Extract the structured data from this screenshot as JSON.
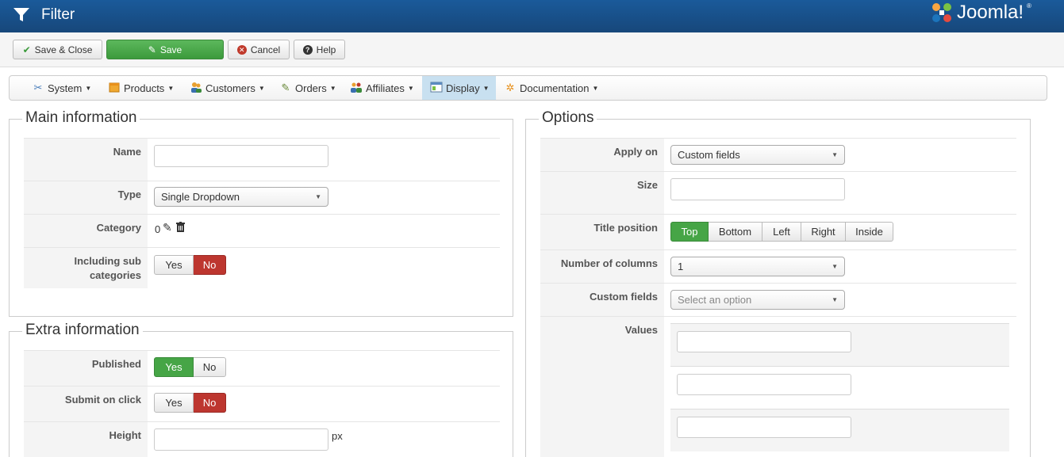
{
  "header": {
    "title": "Filter",
    "logo_text": "Joomla!",
    "logo_mark": "®"
  },
  "toolbar": {
    "save_close": "Save & Close",
    "save": "Save",
    "cancel": "Cancel",
    "help": "Help"
  },
  "menu": {
    "items": [
      {
        "label": "System",
        "icon": "tools-icon"
      },
      {
        "label": "Products",
        "icon": "box-icon"
      },
      {
        "label": "Customers",
        "icon": "users-icon"
      },
      {
        "label": "Orders",
        "icon": "pen-icon"
      },
      {
        "label": "Affiliates",
        "icon": "group-icon"
      },
      {
        "label": "Display",
        "icon": "display-icon",
        "active": true
      },
      {
        "label": "Documentation",
        "icon": "doc-icon"
      }
    ]
  },
  "main_info": {
    "legend": "Main information",
    "name_label": "Name",
    "name_value": "",
    "type_label": "Type",
    "type_value": "Single Dropdown",
    "category_label": "Category",
    "category_value": "0",
    "sub_label_1": "Including sub",
    "sub_label_2": "categories",
    "sub_yes": "Yes",
    "sub_no": "No",
    "sub_selected": "No"
  },
  "extra_info": {
    "legend": "Extra information",
    "published_label": "Published",
    "published_yes": "Yes",
    "published_no": "No",
    "published_selected": "Yes",
    "submit_label": "Submit on click",
    "submit_yes": "Yes",
    "submit_no": "No",
    "submit_selected": "No",
    "height_label": "Height",
    "height_value": "",
    "height_unit": "px"
  },
  "options": {
    "legend": "Options",
    "apply_on_label": "Apply on",
    "apply_on_value": "Custom fields",
    "size_label": "Size",
    "size_value": "",
    "title_position_label": "Title position",
    "title_positions": [
      "Top",
      "Bottom",
      "Left",
      "Right",
      "Inside"
    ],
    "title_position_selected": "Top",
    "columns_label": "Number of columns",
    "columns_value": "1",
    "custom_fields_label": "Custom fields",
    "custom_fields_placeholder": "Select an option",
    "values_label": "Values",
    "values": [
      "",
      "",
      ""
    ]
  },
  "colors": {
    "header_bg": "#17477a",
    "green": "#46a546",
    "red": "#bd362f",
    "active_menu": "#c8e0f0"
  }
}
